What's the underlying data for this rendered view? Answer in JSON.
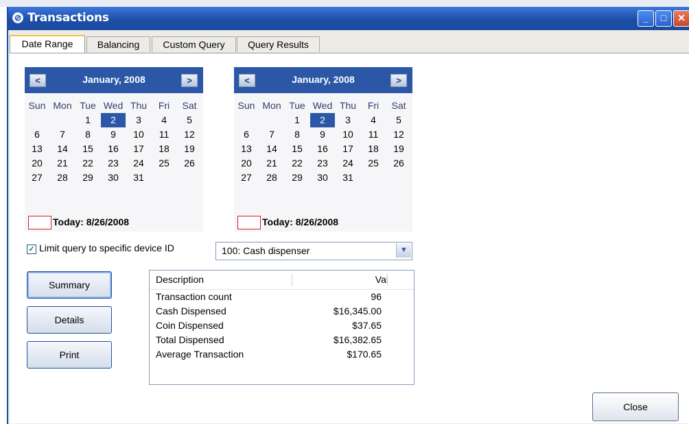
{
  "window": {
    "title": "Transactions",
    "controls": {
      "minimize": "_",
      "maximize": "□",
      "close": "✕"
    }
  },
  "tabs": [
    {
      "label": "Date Range",
      "active": true
    },
    {
      "label": "Balancing",
      "active": false
    },
    {
      "label": "Custom Query",
      "active": false
    },
    {
      "label": "Query Results",
      "active": false
    }
  ],
  "calendars": [
    {
      "title": "January, 2008",
      "prev": "<",
      "next": ">",
      "weekdays": [
        "Sun",
        "Mon",
        "Tue",
        "Wed",
        "Thu",
        "Fri",
        "Sat"
      ],
      "first_weekday_index": 2,
      "days_in_month": 31,
      "selected_day": 2,
      "today_label": "Today: 8/26/2008"
    },
    {
      "title": "January, 2008",
      "prev": "<",
      "next": ">",
      "weekdays": [
        "Sun",
        "Mon",
        "Tue",
        "Wed",
        "Thu",
        "Fri",
        "Sat"
      ],
      "first_weekday_index": 2,
      "days_in_month": 31,
      "selected_day": 2,
      "today_label": "Today: 8/26/2008"
    }
  ],
  "device_filter": {
    "checked": true,
    "label": "Limit query to specific device ID",
    "selected": "100: Cash dispenser"
  },
  "buttons": {
    "summary": "Summary",
    "details": "Details",
    "print": "Print",
    "close": "Close"
  },
  "results": {
    "columns": [
      "Description",
      "Val"
    ],
    "rows": [
      {
        "description": "Transaction count",
        "value": "96"
      },
      {
        "description": "Cash Dispensed",
        "value": "$16,345.00"
      },
      {
        "description": "Coin Dispensed",
        "value": "$37.65"
      },
      {
        "description": "Total Dispensed",
        "value": "$16,382.65"
      },
      {
        "description": "Average Transaction",
        "value": "$170.65"
      }
    ]
  },
  "colors": {
    "titlebar": "#1c4ea6",
    "calendar_header": "#2c57a7",
    "today_border": "#cc2222",
    "tab_active_accent": "#f6c04a"
  }
}
